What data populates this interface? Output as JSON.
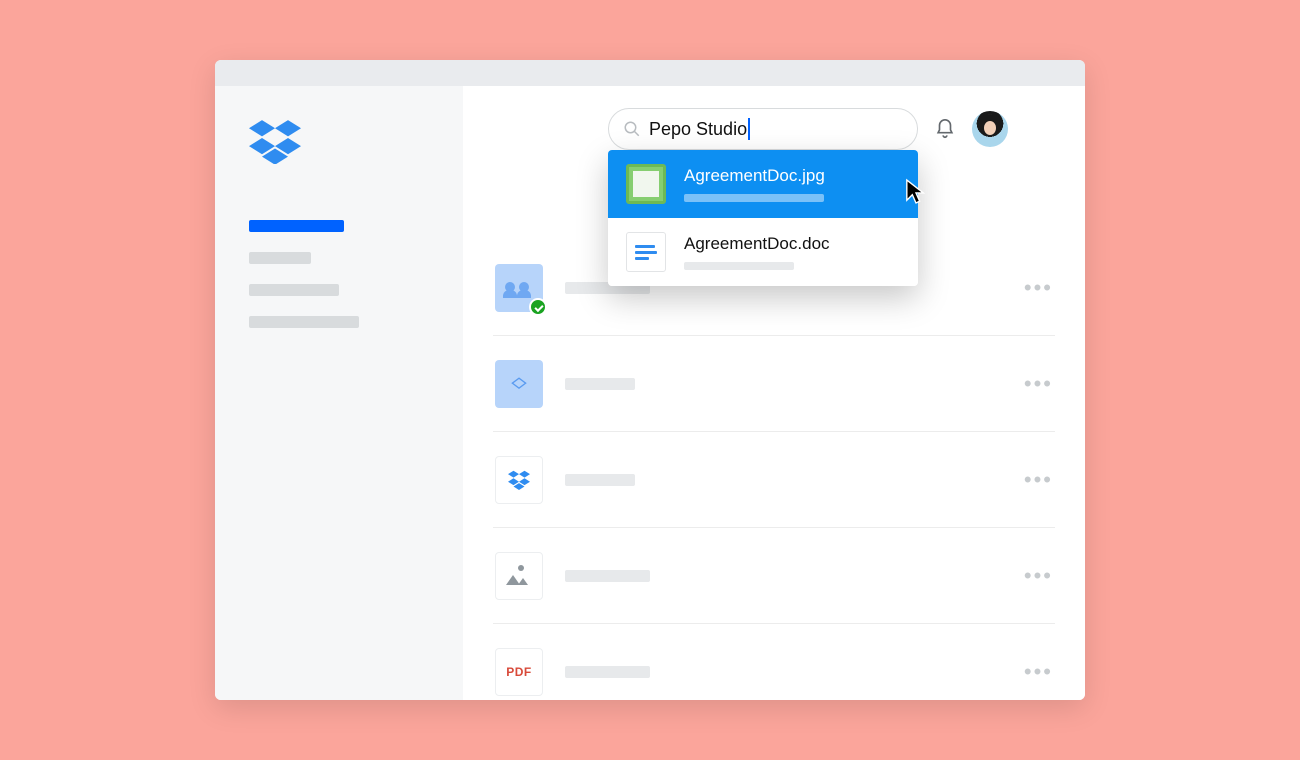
{
  "search": {
    "value": "Pepo Studio"
  },
  "dropdown": {
    "items": [
      {
        "name": "AgreementDoc.jpg",
        "selected": true
      },
      {
        "name": "AgreementDoc.doc",
        "selected": false
      }
    ]
  },
  "pdf_label": "PDF"
}
